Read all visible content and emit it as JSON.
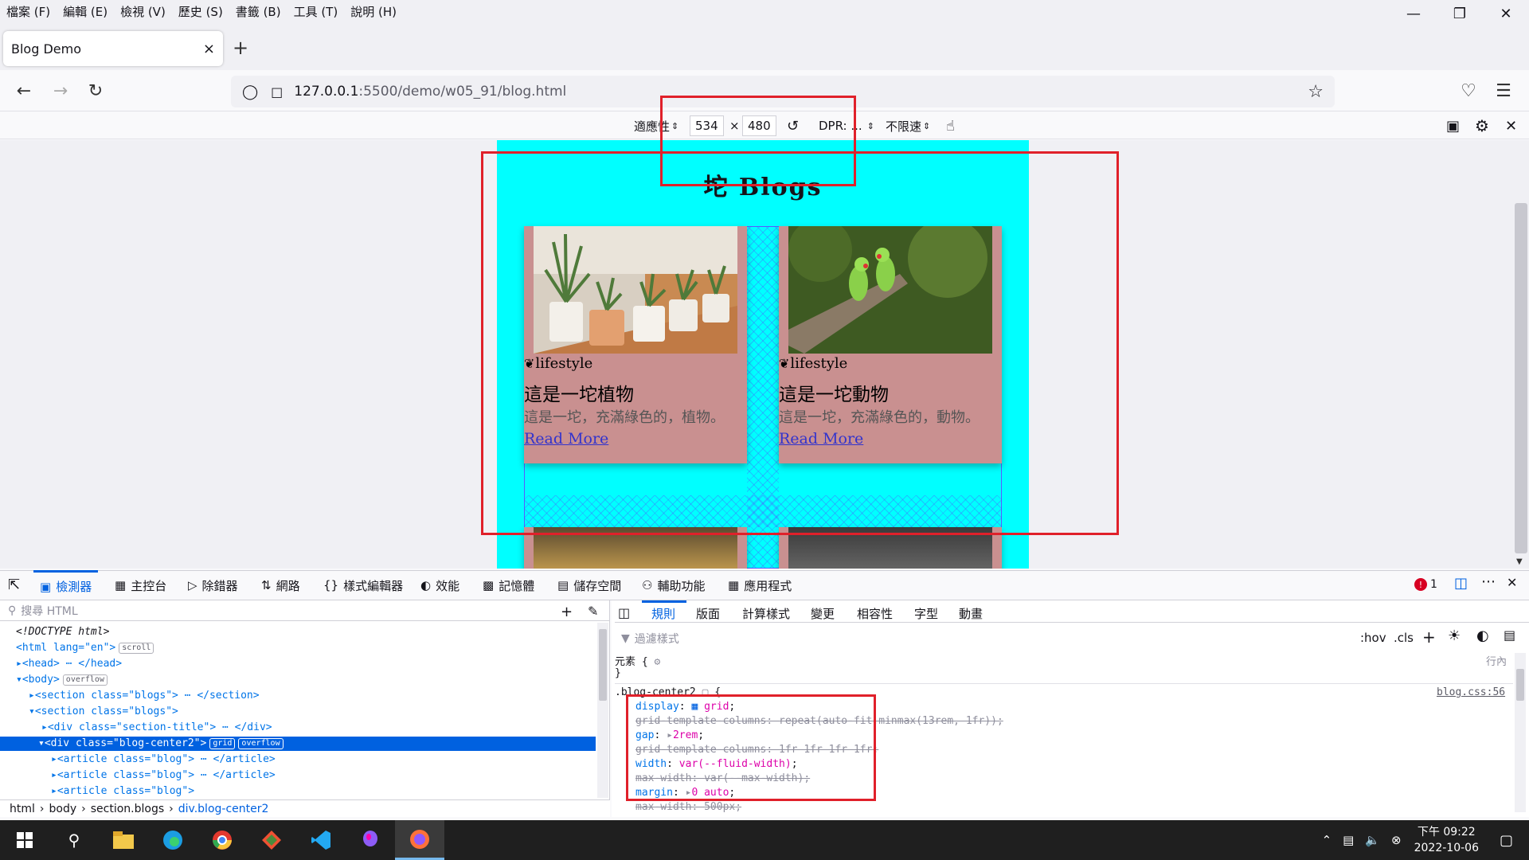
{
  "menu": [
    "檔案 (F)",
    "編輯 (E)",
    "檢視 (V)",
    "歷史 (S)",
    "書籤 (B)",
    "工具 (T)",
    "說明 (H)"
  ],
  "tab": {
    "title": "Blog Demo",
    "close": "×"
  },
  "newtab": "+",
  "url": {
    "host": "127.0.0.1",
    "path": ":5500/demo/w05_91/blog.html"
  },
  "rdm": {
    "device": "適應性",
    "width": "534",
    "times": "×",
    "height": "480",
    "dpr": "DPR: ...",
    "throttle": "不限速"
  },
  "page": {
    "title": "坨 Blogs",
    "cards": [
      {
        "meta": "lifestyle",
        "title": "這是一坨植物",
        "desc": "這是一坨，充滿綠色的，植物。",
        "more": "Read More"
      },
      {
        "meta": "lifestyle",
        "title": "這是一坨動物",
        "desc": "這是一坨，充滿綠色的，動物。",
        "more": "Read More"
      }
    ]
  },
  "devtools": {
    "tabs": [
      "檢測器",
      "主控台",
      "除錯器",
      "網路",
      "樣式編輯器",
      "效能",
      "記憶體",
      "儲存空間",
      "輔助功能",
      "應用程式"
    ],
    "error_count": "1",
    "search_placeholder": "搜尋 HTML",
    "rule_tabs": [
      "規則",
      "版面",
      "計算樣式",
      "變更",
      "相容性",
      "字型",
      "動畫"
    ],
    "filter_placeholder": "過濾樣式",
    "hov": ":hov",
    "cls": ".cls",
    "element_rule": "元素 {",
    "inline": "行內",
    "selector": ".blog-center2",
    "file": "blog.css:56",
    "html_lines": [
      "<!DOCTYPE html>",
      "<html lang=\"en\">",
      "<head>",
      "<body>",
      "<section class=\"blogs\">",
      "<section class=\"blogs\">",
      "<div class=\"section-title\">",
      "<div class=\"blog-center2\">",
      "<article class=\"blog\">",
      "<article class=\"blog\">",
      "<article class=\"blog\">"
    ],
    "breadcrumbs": [
      "html",
      "body",
      "section.blogs",
      "div.blog-center2"
    ],
    "badges": {
      "scroll": "scroll",
      "overflow": "overflow",
      "grid": "grid"
    },
    "css": [
      {
        "prop": "display",
        "val": "grid",
        "strike": false
      },
      {
        "prop": "grid-template-columns",
        "val": "repeat(auto-fit,minmax(13rem, 1fr))",
        "strike": true
      },
      {
        "prop": "gap",
        "val": "2rem",
        "strike": false
      },
      {
        "prop": "grid-template-columns",
        "val": "1fr 1fr 1fr 1fr",
        "strike": true
      },
      {
        "prop": "width",
        "val": "var(--fluid-width)",
        "strike": false
      },
      {
        "prop": "max-width",
        "val": "var(--max-width)",
        "strike": true
      },
      {
        "prop": "margin",
        "val": "0 auto",
        "strike": false
      },
      {
        "prop": "max-width",
        "val": "500px",
        "strike": true
      }
    ]
  },
  "taskbar": {
    "time": "下午 09:22",
    "date": "2022-10-06"
  }
}
